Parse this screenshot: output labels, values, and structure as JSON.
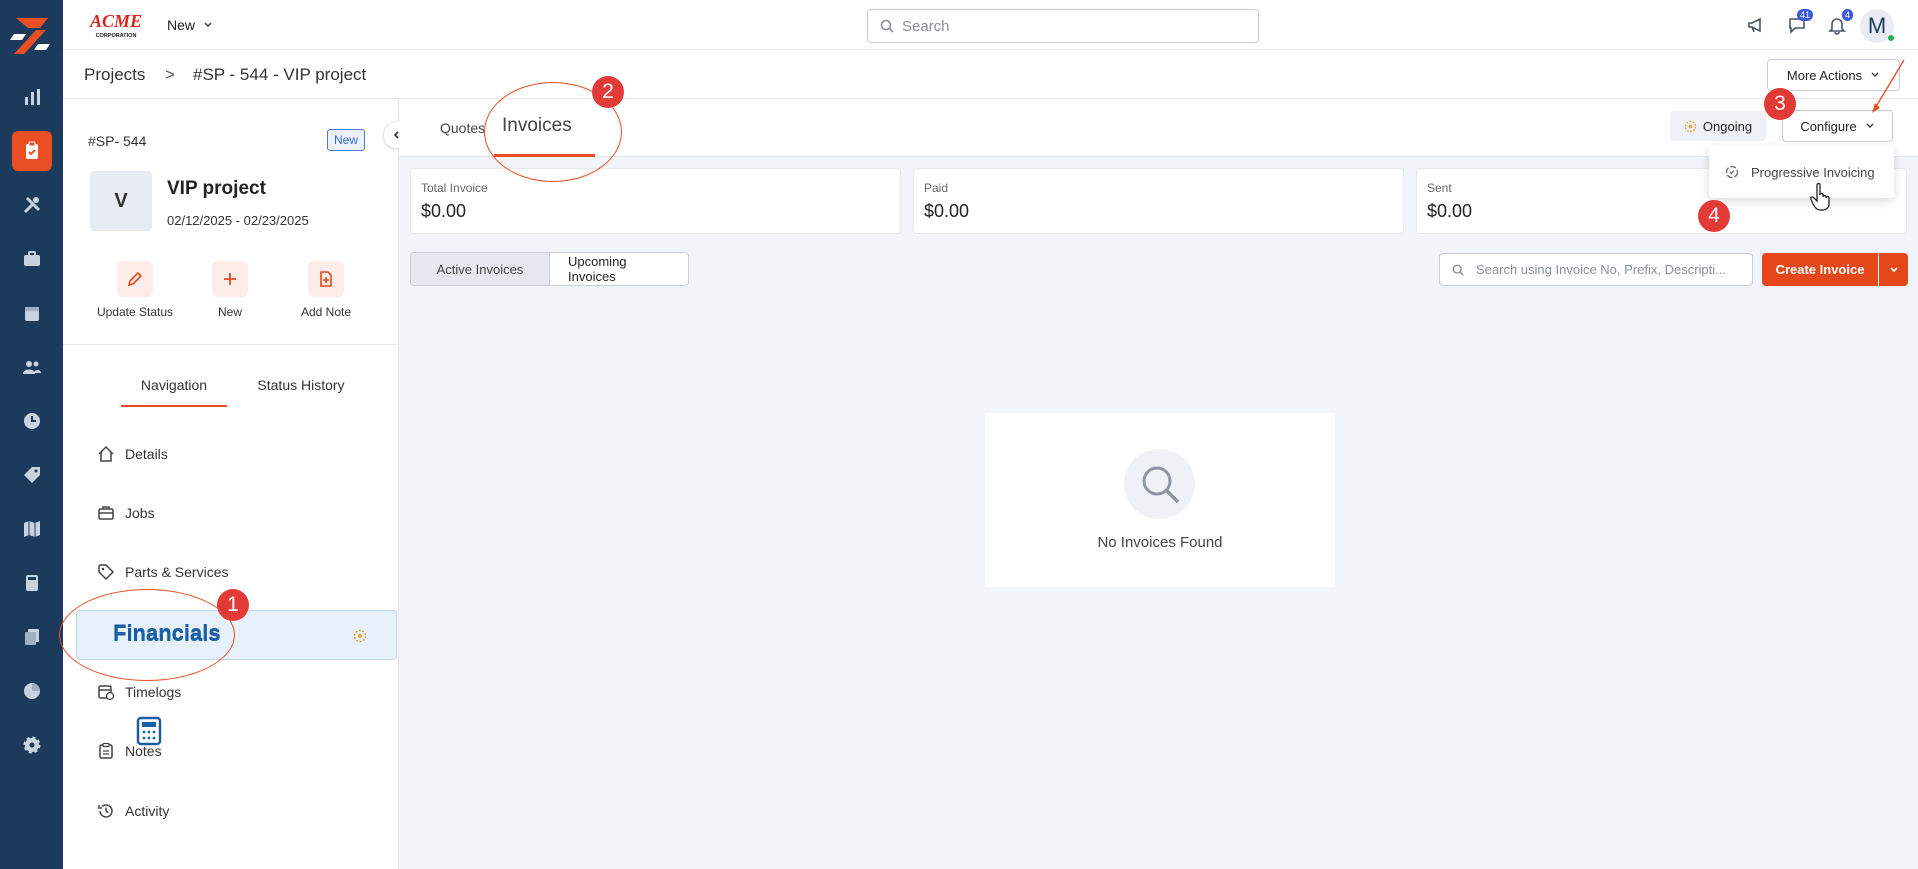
{
  "topbar": {
    "brand_text": "ACME CORPORATION",
    "new_label": "New",
    "search_placeholder": "Search",
    "messages_badge": "41",
    "notifications_badge": "4",
    "avatar_initial": "M"
  },
  "breadcrumb": {
    "root": "Projects",
    "separator": ">",
    "current": "#SP - 544 - VIP project",
    "more_actions": "More Actions"
  },
  "project": {
    "id": "#SP- 544",
    "status_badge": "New",
    "avatar_letter": "V",
    "name": "VIP project",
    "dates": "02/12/2025 - 02/23/2025",
    "actions": [
      "Update Status",
      "New",
      "Add Note"
    ]
  },
  "left_tabs": {
    "navigation": "Navigation",
    "status_history": "Status History"
  },
  "nav_items": [
    {
      "label": "Details",
      "icon": "home-icon"
    },
    {
      "label": "Jobs",
      "icon": "briefcase-icon"
    },
    {
      "label": "Parts & Services",
      "icon": "tag-icon"
    },
    {
      "label": "Financials",
      "icon": "calculator-icon"
    },
    {
      "label": "Timelogs",
      "icon": "calendar-clock-icon"
    },
    {
      "label": "Notes",
      "icon": "clipboard-icon"
    },
    {
      "label": "Activity",
      "icon": "history-icon"
    }
  ],
  "main": {
    "tab_quotes": "Quotes",
    "tab_invoices": "Invoices",
    "ongoing": "Ongoing",
    "configure": "Configure",
    "dropdown_item": "Progressive Invoicing",
    "cards": [
      {
        "label": "Total Invoice",
        "value": "$0.00"
      },
      {
        "label": "Paid",
        "value": "$0.00"
      },
      {
        "label": "Sent",
        "value": "$0.00"
      }
    ],
    "segments": [
      "Active Invoices",
      "Upcoming Invoices"
    ],
    "invoice_search_placeholder": "Search using Invoice No, Prefix, Descripti...",
    "create_invoice": "Create Invoice",
    "empty_text": "No Invoices Found"
  },
  "annotations": [
    "1",
    "2",
    "3",
    "4"
  ],
  "colors": {
    "rail_bg": "#1b3a5c",
    "accent": "#ea4f24",
    "primary_button": "#e4481a",
    "active_nav_bg": "#e6f1fb",
    "annotation_red": "#e23a36"
  }
}
